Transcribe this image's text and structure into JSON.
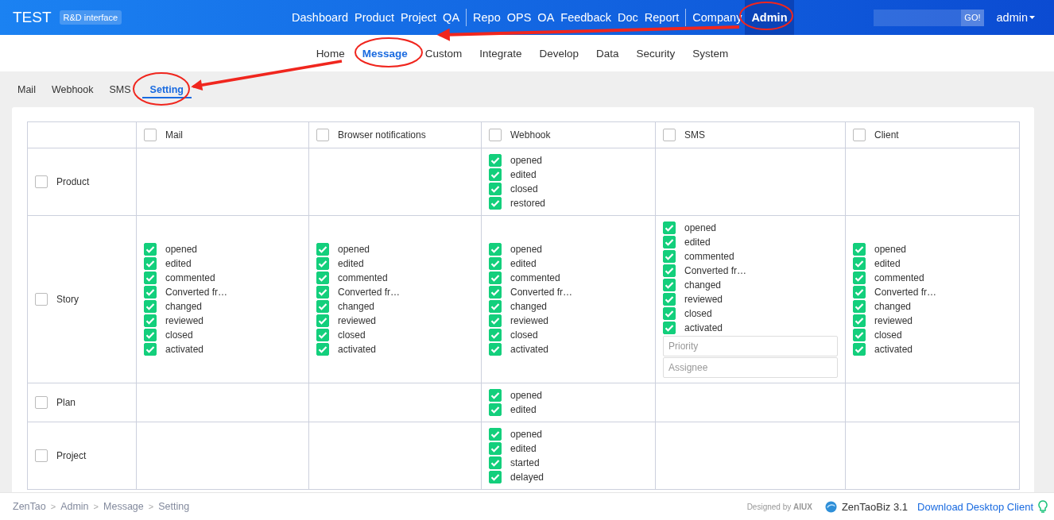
{
  "header": {
    "brand": "TEST",
    "badge": "R&D interface",
    "nav_groups": [
      [
        {
          "label": "Dashboard",
          "selected": false
        },
        {
          "label": "Product",
          "selected": false
        },
        {
          "label": "Project",
          "selected": false
        },
        {
          "label": "QA",
          "selected": false
        }
      ],
      [
        {
          "label": "Repo",
          "selected": false
        },
        {
          "label": "OPS",
          "selected": false
        },
        {
          "label": "OA",
          "selected": false
        },
        {
          "label": "Feedback",
          "selected": false
        },
        {
          "label": "Doc",
          "selected": false
        },
        {
          "label": "Report",
          "selected": false
        }
      ],
      [
        {
          "label": "Company",
          "selected": false
        },
        {
          "label": "Admin",
          "selected": true
        }
      ]
    ],
    "search_button": "GO!",
    "user": "admin"
  },
  "sub_nav": [
    {
      "label": "Home",
      "selected": false
    },
    {
      "label": "Message",
      "selected": true
    },
    {
      "label": "Custom",
      "selected": false
    },
    {
      "label": "Integrate",
      "selected": false
    },
    {
      "label": "Develop",
      "selected": false
    },
    {
      "label": "Data",
      "selected": false
    },
    {
      "label": "Security",
      "selected": false
    },
    {
      "label": "System",
      "selected": false
    }
  ],
  "tabs": [
    {
      "label": "Mail",
      "selected": false
    },
    {
      "label": "Webhook",
      "selected": false
    },
    {
      "label": "SMS",
      "selected": false
    },
    {
      "label": "Setting",
      "selected": true
    }
  ],
  "table": {
    "columns": [
      {
        "label": "Mail",
        "checked": false
      },
      {
        "label": "Browser notifications",
        "checked": false
      },
      {
        "label": "Webhook",
        "checked": false
      },
      {
        "label": "SMS",
        "checked": false
      },
      {
        "label": "Client",
        "checked": false
      }
    ],
    "rows": [
      {
        "label": "Product",
        "checked": false,
        "cells": [
          {},
          {},
          {
            "items": [
              {
                "label": "opened",
                "checked": true
              },
              {
                "label": "edited",
                "checked": true
              },
              {
                "label": "closed",
                "checked": true
              },
              {
                "label": "restored",
                "checked": true
              }
            ]
          },
          {},
          {}
        ]
      },
      {
        "label": "Story",
        "checked": false,
        "cells": [
          {
            "items": [
              {
                "label": "opened",
                "checked": true
              },
              {
                "label": "edited",
                "checked": true
              },
              {
                "label": "commented",
                "checked": true
              },
              {
                "label": "Converted fr…",
                "checked": true
              },
              {
                "label": "changed",
                "checked": true
              },
              {
                "label": "reviewed",
                "checked": true
              },
              {
                "label": "closed",
                "checked": true
              },
              {
                "label": "activated",
                "checked": true
              }
            ]
          },
          {
            "items": [
              {
                "label": "opened",
                "checked": true
              },
              {
                "label": "edited",
                "checked": true
              },
              {
                "label": "commented",
                "checked": true
              },
              {
                "label": "Converted fr…",
                "checked": true
              },
              {
                "label": "changed",
                "checked": true
              },
              {
                "label": "reviewed",
                "checked": true
              },
              {
                "label": "closed",
                "checked": true
              },
              {
                "label": "activated",
                "checked": true
              }
            ]
          },
          {
            "items": [
              {
                "label": "opened",
                "checked": true
              },
              {
                "label": "edited",
                "checked": true
              },
              {
                "label": "commented",
                "checked": true
              },
              {
                "label": "Converted fr…",
                "checked": true
              },
              {
                "label": "changed",
                "checked": true
              },
              {
                "label": "reviewed",
                "checked": true
              },
              {
                "label": "closed",
                "checked": true
              },
              {
                "label": "activated",
                "checked": true
              }
            ]
          },
          {
            "items": [
              {
                "label": "opened",
                "checked": true
              },
              {
                "label": "edited",
                "checked": true
              },
              {
                "label": "commented",
                "checked": true
              },
              {
                "label": "Converted fr…",
                "checked": true
              },
              {
                "label": "changed",
                "checked": true
              },
              {
                "label": "reviewed",
                "checked": true
              },
              {
                "label": "closed",
                "checked": true
              },
              {
                "label": "activated",
                "checked": true
              }
            ],
            "fields": [
              {
                "placeholder": "Priority"
              },
              {
                "placeholder": "Assignee"
              }
            ]
          },
          {
            "items": [
              {
                "label": "opened",
                "checked": true
              },
              {
                "label": "edited",
                "checked": true
              },
              {
                "label": "commented",
                "checked": true
              },
              {
                "label": "Converted fr…",
                "checked": true
              },
              {
                "label": "changed",
                "checked": true
              },
              {
                "label": "reviewed",
                "checked": true
              },
              {
                "label": "closed",
                "checked": true
              },
              {
                "label": "activated",
                "checked": true
              }
            ]
          }
        ]
      },
      {
        "label": "Plan",
        "checked": false,
        "cells": [
          {},
          {},
          {
            "items": [
              {
                "label": "opened",
                "checked": true
              },
              {
                "label": "edited",
                "checked": true
              }
            ]
          },
          {},
          {}
        ]
      },
      {
        "label": "Project",
        "checked": false,
        "cells": [
          {},
          {},
          {
            "items": [
              {
                "label": "opened",
                "checked": true
              },
              {
                "label": "edited",
                "checked": true
              },
              {
                "label": "started",
                "checked": true
              },
              {
                "label": "delayed",
                "checked": true
              }
            ]
          },
          {},
          {}
        ]
      }
    ]
  },
  "footer": {
    "breadcrumb": [
      "ZenTao",
      "Admin",
      "Message",
      "Setting"
    ],
    "separator": ">",
    "designed_by": "Designed by **AIUX**",
    "version": "ZenTaoBiz 3.1",
    "download_link": "Download Desktop Client"
  }
}
